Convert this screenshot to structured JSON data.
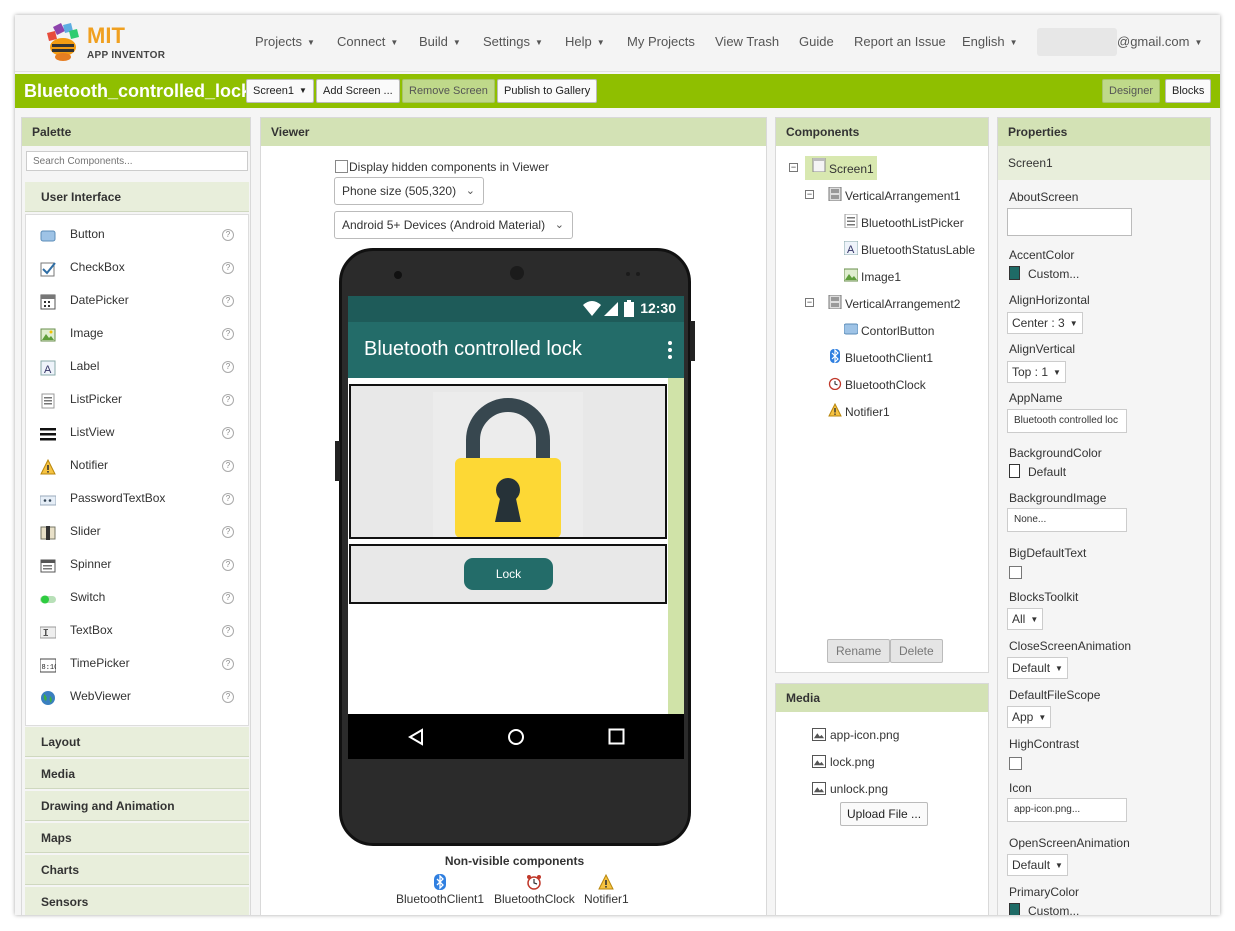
{
  "nav": {
    "logo_mit": "MIT",
    "logo_sub": "APP INVENTOR",
    "items": [
      "Projects",
      "Connect",
      "Build",
      "Settings",
      "Help"
    ],
    "links": [
      "My Projects",
      "View Trash",
      "Guide",
      "Report an Issue"
    ],
    "language": "English",
    "account": "@gmail.com"
  },
  "toolbar": {
    "project_name": "Bluetooth_controlled_lock",
    "screen_select": "Screen1",
    "add_screen": "Add Screen ...",
    "remove_screen": "Remove Screen",
    "publish": "Publish to Gallery",
    "designer": "Designer",
    "blocks": "Blocks"
  },
  "palette": {
    "title": "Palette",
    "search_placeholder": "Search Components...",
    "open_category": "User Interface",
    "items": [
      "Button",
      "CheckBox",
      "DatePicker",
      "Image",
      "Label",
      "ListPicker",
      "ListView",
      "Notifier",
      "PasswordTextBox",
      "Slider",
      "Spinner",
      "Switch",
      "TextBox",
      "TimePicker",
      "WebViewer"
    ],
    "help_glyph": "?",
    "categories": [
      "Layout",
      "Media",
      "Drawing and Animation",
      "Maps",
      "Charts",
      "Sensors"
    ]
  },
  "viewer": {
    "title": "Viewer",
    "hidden_label": "Display hidden components in Viewer",
    "phone_size": "Phone size (505,320)",
    "theme": "Android 5+ Devices (Android Material)",
    "status_time": "12:30",
    "app_title": "Bluetooth controlled lock",
    "lock_button": "Lock",
    "nonvisible_title": "Non-visible components",
    "nonvisible": [
      "BluetoothClient1",
      "BluetoothClock",
      "Notifier1"
    ]
  },
  "components": {
    "title": "Components",
    "toggle_glyph": "−",
    "tree": [
      {
        "label": "Screen1",
        "icon": "screen-icon"
      },
      {
        "label": "VerticalArrangement1",
        "icon": "vertical-arrangement-icon"
      },
      {
        "label": "BluetoothListPicker",
        "icon": "listpicker-icon"
      },
      {
        "label": "BluetoothStatusLable",
        "icon": "label-icon"
      },
      {
        "label": "Image1",
        "icon": "image-icon"
      },
      {
        "label": "VerticalArrangement2",
        "icon": "vertical-arrangement-icon"
      },
      {
        "label": "ContorlButton",
        "icon": "button-icon"
      },
      {
        "label": "BluetoothClient1",
        "icon": "bluetooth-icon"
      },
      {
        "label": "BluetoothClock",
        "icon": "clock-icon"
      },
      {
        "label": "Notifier1",
        "icon": "notifier-icon"
      }
    ],
    "rename": "Rename",
    "delete": "Delete"
  },
  "media": {
    "title": "Media",
    "files": [
      "app-icon.png",
      "lock.png",
      "unlock.png"
    ],
    "upload": "Upload File ..."
  },
  "properties": {
    "title": "Properties",
    "component": "Screen1",
    "about_screen": "AboutScreen",
    "accent_color": {
      "label": "AccentColor",
      "value": "Custom...",
      "swatch": "#1e6b66"
    },
    "align_horizontal": {
      "label": "AlignHorizontal",
      "value": "Center : 3"
    },
    "align_vertical": {
      "label": "AlignVertical",
      "value": "Top : 1"
    },
    "app_name": {
      "label": "AppName",
      "value": "Bluetooth controlled loc"
    },
    "background_color": {
      "label": "BackgroundColor",
      "value": "Default",
      "swatch": "#ffffff"
    },
    "background_image": {
      "label": "BackgroundImage",
      "value": "None..."
    },
    "big_default_text": {
      "label": "BigDefaultText"
    },
    "blocks_toolkit": {
      "label": "BlocksToolkit",
      "value": "All"
    },
    "close_screen_animation": {
      "label": "CloseScreenAnimation",
      "value": "Default"
    },
    "default_file_scope": {
      "label": "DefaultFileScope",
      "value": "App"
    },
    "high_contrast": {
      "label": "HighContrast"
    },
    "icon": {
      "label": "Icon",
      "value": "app-icon.png..."
    },
    "open_screen_animation": {
      "label": "OpenScreenAnimation",
      "value": "Default"
    },
    "primary_color": {
      "label": "PrimaryColor",
      "value": "Custom...",
      "swatch": "#1e6b66"
    }
  },
  "colors": {
    "brand_green": "#8fbf00",
    "panel_header": "#d3e2b5",
    "app_bar": "#236c69",
    "status_bar": "#1e5b59"
  }
}
